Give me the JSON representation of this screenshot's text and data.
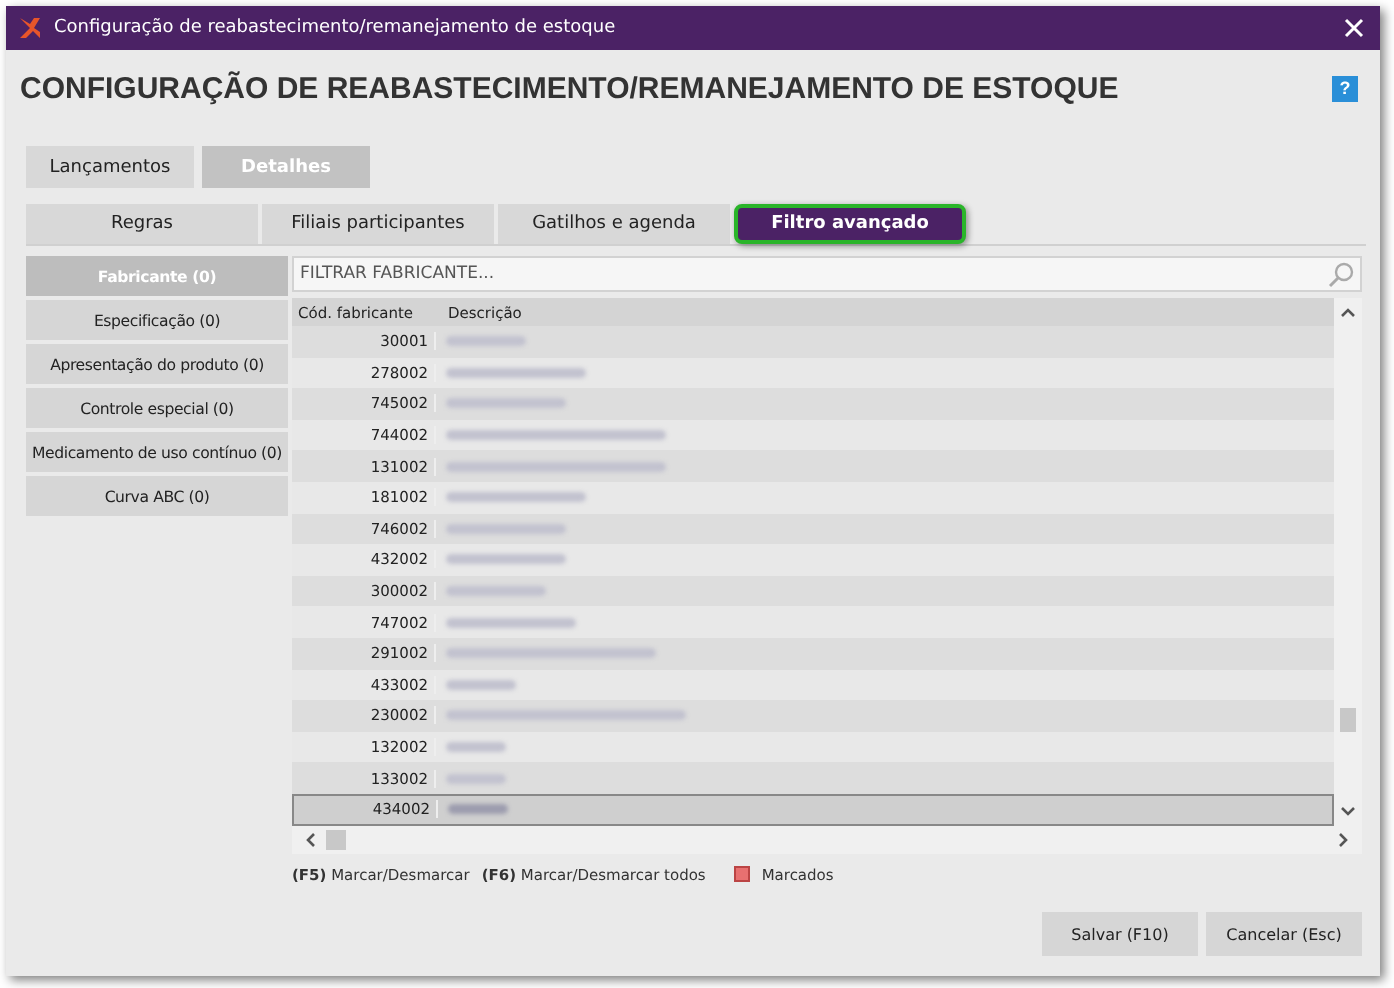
{
  "window": {
    "title": "Configuração de reabastecimento/remanejamento de estoque"
  },
  "heading": "CONFIGURAÇÃO DE REABASTECIMENTO/REMANEJAMENTO DE ESTOQUE",
  "help": "?",
  "tabs": [
    {
      "label": "Lançamentos",
      "selected": false
    },
    {
      "label": "Detalhes",
      "selected": true
    }
  ],
  "subtabs": [
    {
      "label": "Regras",
      "selected": false
    },
    {
      "label": "Filiais participantes",
      "selected": false
    },
    {
      "label": "Gatilhos e agenda",
      "selected": false
    },
    {
      "label": "Filtro avançado",
      "selected": true
    }
  ],
  "filters": [
    {
      "label": "Fabricante (0)",
      "selected": true
    },
    {
      "label": "Especificação (0)",
      "selected": false
    },
    {
      "label": "Apresentação do produto (0)",
      "selected": false
    },
    {
      "label": "Controle especial (0)",
      "selected": false
    },
    {
      "label": "Medicamento de uso contínuo (0)",
      "selected": false
    },
    {
      "label": "Curva ABC (0)",
      "selected": false
    }
  ],
  "search": {
    "placeholder": "FILTRAR FABRICANTE..."
  },
  "table": {
    "columns": [
      "Cód. fabricante",
      "Descrição"
    ],
    "rows": [
      {
        "code": "30001",
        "selected": false
      },
      {
        "code": "278002",
        "selected": false
      },
      {
        "code": "745002",
        "selected": false
      },
      {
        "code": "744002",
        "selected": false
      },
      {
        "code": "131002",
        "selected": false
      },
      {
        "code": "181002",
        "selected": false
      },
      {
        "code": "746002",
        "selected": false
      },
      {
        "code": "432002",
        "selected": false
      },
      {
        "code": "300002",
        "selected": false
      },
      {
        "code": "747002",
        "selected": false
      },
      {
        "code": "291002",
        "selected": false
      },
      {
        "code": "433002",
        "selected": false
      },
      {
        "code": "230002",
        "selected": false
      },
      {
        "code": "132002",
        "selected": false
      },
      {
        "code": "133002",
        "selected": false
      },
      {
        "code": "434002",
        "selected": true
      }
    ]
  },
  "legend": [
    {
      "key": "(F5)",
      "text": "Marcar/Desmarcar"
    },
    {
      "key": "(F6)",
      "text": "Marcar/Desmarcar todos"
    }
  ],
  "marked_legend": {
    "text": "Marcados",
    "color": "#e87070"
  },
  "buttons": [
    "Salvar (F10)",
    "Cancelar (Esc)"
  ]
}
